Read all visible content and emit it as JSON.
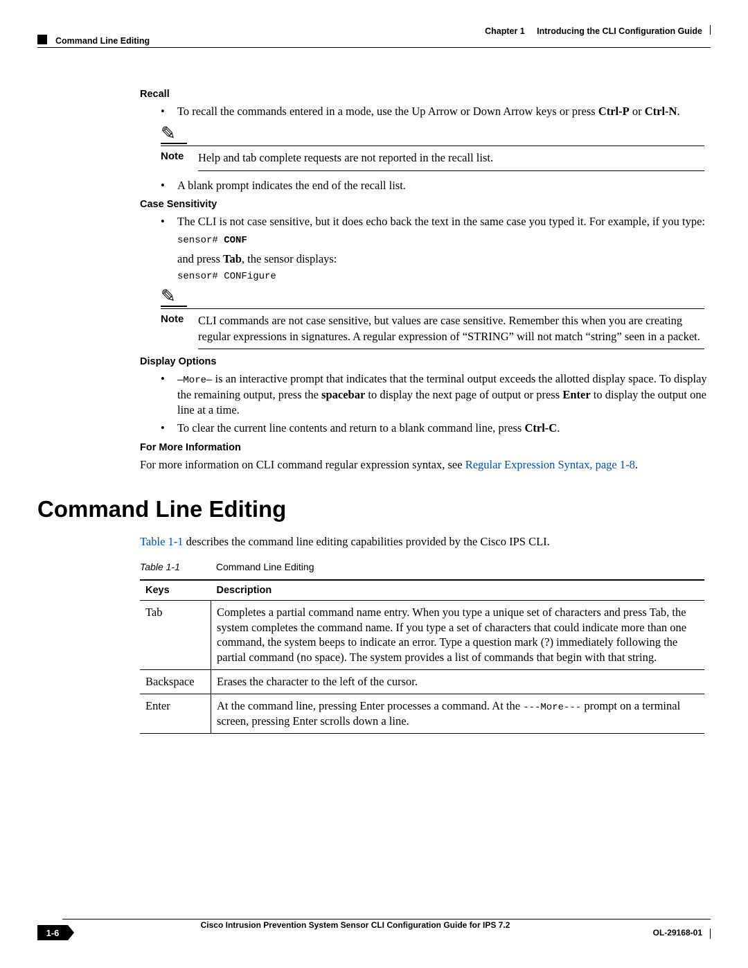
{
  "header": {
    "chapter_prefix": "Chapter 1",
    "chapter_title": "Introducing the CLI Configuration Guide",
    "section_label": "Command Line Editing"
  },
  "sections": {
    "recall": {
      "title": "Recall",
      "b1_a": "To recall the commands entered in a mode, use the Up Arrow or Down Arrow keys or press ",
      "b1_b": "Ctrl-P",
      "b1_c": " or ",
      "b1_d": "Ctrl-N",
      "b1_e": ".",
      "note_label": "Note",
      "note_text": "Help and tab complete requests are not reported in the recall list.",
      "b2": "A blank prompt indicates the end of the recall list."
    },
    "case": {
      "title": "Case Sensitivity",
      "b1": "The CLI is not case sensitive, but it does echo back the text in the same case you typed it. For example, if you type:",
      "code1a": "sensor# ",
      "code1b": "CONF",
      "after_a": "and press ",
      "after_b": "Tab",
      "after_c": ", the sensor displays:",
      "code2": "sensor# CONFigure",
      "note_label": "Note",
      "note_text": "CLI commands are not case sensitive, but values are case sensitive. Remember this when you are creating regular expressions in signatures. A regular expression of “STRING” will not match “string” seen in a packet."
    },
    "display": {
      "title": "Display Options",
      "b1_a": "—More—",
      "b1_b": " is an interactive prompt that indicates that the terminal output exceeds the allotted display space. To display the remaining output, press the ",
      "b1_c": "spacebar",
      "b1_d": " to display the next page of output or press ",
      "b1_e": "Enter",
      "b1_f": " to display the output one line at a time.",
      "b2_a": "To clear the current line contents and return to a blank command line, press ",
      "b2_b": "Ctrl-C",
      "b2_c": "."
    },
    "more": {
      "title": "For More Information",
      "text_a": "For more information on CLI command regular expression syntax, see ",
      "link": "Regular Expression Syntax, page 1-8",
      "text_b": "."
    }
  },
  "h1": "Command Line Editing",
  "intro": {
    "ref": "Table 1-1",
    "rest": " describes the command line editing capabilities provided by the Cisco IPS CLI."
  },
  "table": {
    "caption_no": "Table 1-1",
    "caption_title": "Command Line Editing",
    "cols": {
      "keys": "Keys",
      "desc": "Description"
    },
    "rows": [
      {
        "k": "Tab",
        "d": "Completes a partial command name entry. When you type a unique set of characters and press Tab, the system completes the command name. If you type a set of characters that could indicate more than one command, the system beeps to indicate an error. Type a question mark (?) immediately following the partial command (no space). The system provides a list of commands that begin with that string."
      },
      {
        "k": "Backspace",
        "d": "Erases the character to the left of the cursor."
      },
      {
        "k": "Enter",
        "d_a": "At the command line, pressing Enter processes a command. At the ",
        "d_more": "---More---",
        "d_b": " prompt on a terminal screen, pressing Enter scrolls down a line."
      }
    ]
  },
  "footer": {
    "title": "Cisco Intrusion Prevention System Sensor CLI Configuration Guide for IPS 7.2",
    "page": "1-6",
    "docno": "OL-29168-01"
  },
  "pen_icon": "✎"
}
